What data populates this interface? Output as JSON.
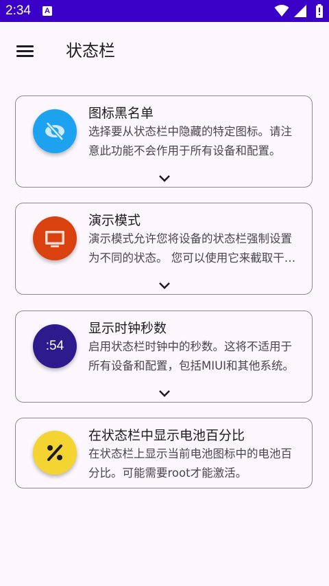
{
  "status_bar": {
    "time": "2:34",
    "notification_icon": "a-letter-icon",
    "icons": [
      "wifi-icon",
      "signal-icon",
      "battery-icon"
    ]
  },
  "app_bar": {
    "menu_icon": "hamburger-menu-icon",
    "title": "状态栏"
  },
  "cards": [
    {
      "title": "图标黑名单",
      "description": "选择要从状态栏中隐藏的特定图标。请注意此功能不会作用于所有设备和配置。",
      "icon": "eye-off-icon",
      "icon_color": "#1da2f0",
      "expandable": true
    },
    {
      "title": "演示模式",
      "description": "演示模式允许您将设备的状态栏强制设置为不同的状态。 您可以使用它来截取干净的屏幕截图。",
      "icon": "monitor-icon",
      "icon_color": "#d9420f",
      "expandable": true
    },
    {
      "title": "显示时钟秒数",
      "description": "启用状态栏时钟中的秒数。这将不适用于所有设备和配置，包括MIUI和其他系统。",
      "icon_text": ":54",
      "icon_color": "#2d1a8d",
      "expandable": true
    },
    {
      "title": "在状态栏中显示电池百分比",
      "description": "在状态栏上显示当前电池图标中的电池百分比。可能需要root才能激活。",
      "icon": "percent-icon",
      "icon_color": "#f4d431",
      "expandable": false
    }
  ],
  "colors": {
    "status_bar": "#3a00c8",
    "background": "#fcf7fd",
    "card_border": "#8a8a8a"
  }
}
